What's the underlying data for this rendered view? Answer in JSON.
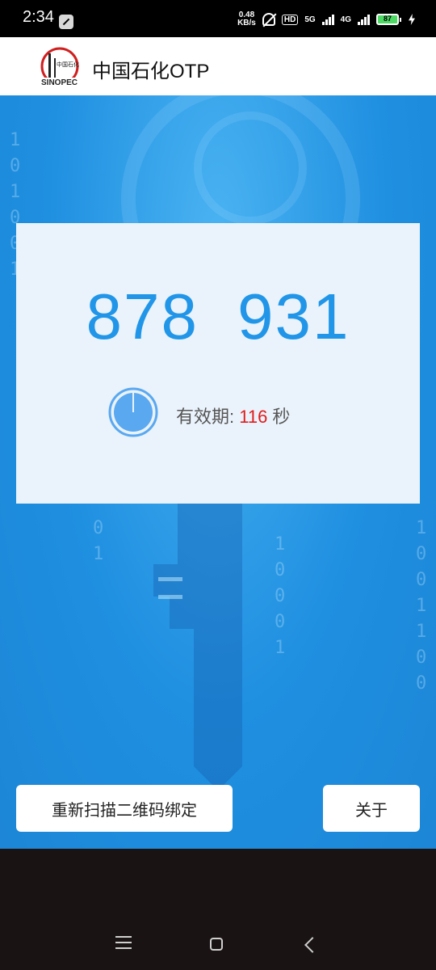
{
  "status_bar": {
    "time": "2:34",
    "net_speed_value": "0.48",
    "net_speed_unit": "KB/s",
    "hd_label": "HD",
    "network_5g": "5G",
    "network_4g": "4G",
    "battery_level": "87"
  },
  "app_bar": {
    "title": "中国石化OTP",
    "logo_text": "中国石化 SINOPEC"
  },
  "otp": {
    "code_part1": "878",
    "code_part2": "931",
    "validity_label": "有效期: ",
    "seconds_remaining": "116",
    "seconds_unit": " 秒"
  },
  "buttons": {
    "rescan_label": "重新扫描二维码绑定",
    "about_label": "关于"
  },
  "colors": {
    "accent": "#2196e8",
    "countdown": "#e01c1c",
    "background_blue": "#1f8fe0"
  }
}
